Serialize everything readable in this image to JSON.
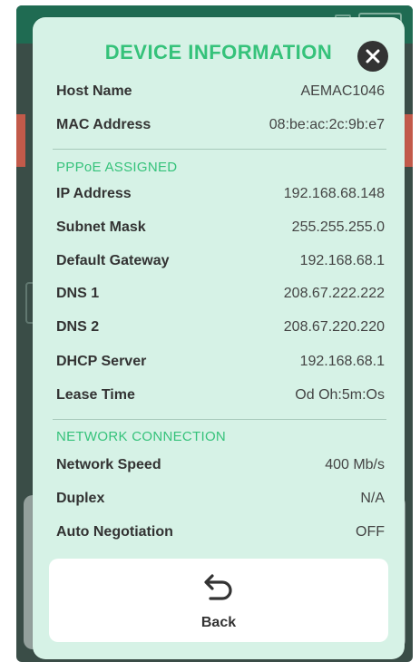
{
  "modal": {
    "title": "DEVICE INFORMATION",
    "accent_color": "#35c27a",
    "close_icon": "close-icon"
  },
  "device_rows": [
    {
      "label": "Host Name",
      "value": "AEMAC1046"
    },
    {
      "label": "MAC Address",
      "value": "08:be:ac:2c:9b:e7"
    }
  ],
  "pppoe": {
    "header": "PPPoE ASSIGNED",
    "rows": [
      {
        "label": "IP Address",
        "value": "192.168.68.148"
      },
      {
        "label": "Subnet Mask",
        "value": "255.255.255.0"
      },
      {
        "label": "Default Gateway",
        "value": "192.168.68.1"
      },
      {
        "label": "DNS 1",
        "value": "208.67.222.222"
      },
      {
        "label": "DNS 2",
        "value": "208.67.220.220"
      },
      {
        "label": "DHCP Server",
        "value": "192.168.68.1"
      },
      {
        "label": "Lease Time",
        "value": "Od Oh:5m:Os"
      }
    ]
  },
  "network": {
    "header": "NETWORK CONNECTION",
    "rows": [
      {
        "label": "Network Speed",
        "value": "400 Mb/s"
      },
      {
        "label": "Duplex",
        "value": "N/A"
      },
      {
        "label": "Auto Negotiation",
        "value": "OFF"
      }
    ]
  },
  "back_button": {
    "label": "Back",
    "icon": "back-arrow-icon"
  }
}
